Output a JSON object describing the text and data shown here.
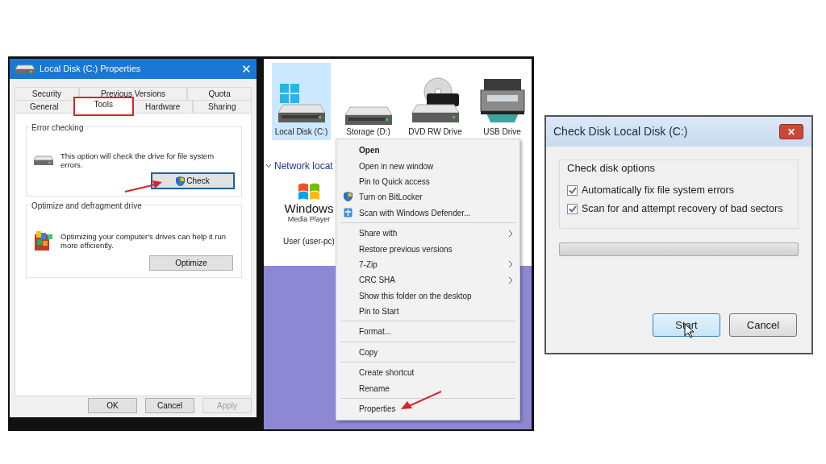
{
  "properties_dialog": {
    "title": "Local Disk (C:) Properties",
    "tab_rows": [
      [
        {
          "label": "Security",
          "selected": false,
          "highlighted": false
        },
        {
          "label": "Previous Versions",
          "selected": false,
          "highlighted": false
        },
        {
          "label": "Quota",
          "selected": false,
          "highlighted": false
        }
      ],
      [
        {
          "label": "General",
          "selected": false,
          "highlighted": false
        },
        {
          "label": "Tools",
          "selected": true,
          "highlighted": true
        },
        {
          "label": "Hardware",
          "selected": false,
          "highlighted": false
        },
        {
          "label": "Sharing",
          "selected": false,
          "highlighted": false
        }
      ]
    ],
    "groups": [
      {
        "title": "Error checking",
        "kind": "drive",
        "text": "This option will check the drive for file system errors.",
        "button": {
          "label": "Check",
          "focused": true,
          "shield": true,
          "pointer_arrow": true
        }
      },
      {
        "title": "Optimize and defragment drive",
        "kind": "defrag",
        "text": "Optimizing your computer's drives can help it run more efficiently.",
        "button": {
          "label": "Optimize",
          "focused": false,
          "shield": false,
          "pointer_arrow": false
        }
      }
    ],
    "buttons": [
      {
        "label": "OK",
        "disabled": false
      },
      {
        "label": "Cancel",
        "disabled": false
      },
      {
        "label": "Apply",
        "disabled": true
      }
    ],
    "close": "✕"
  },
  "explorer": {
    "drives": [
      {
        "label": "Local Disk (C:)",
        "kind": "windows-drive",
        "selected": true
      },
      {
        "label": "Storage (D:)",
        "kind": "drive",
        "selected": false
      },
      {
        "label": "DVD RW Drive",
        "kind": "dvd",
        "selected": false
      },
      {
        "label": "USB Drive",
        "kind": "printer",
        "selected": false
      }
    ],
    "section": {
      "label": "Network locat",
      "expanded": true
    },
    "network_items": [
      {
        "logo_text": [
          "Windows",
          "Media Player"
        ],
        "label": "User (user-pc)"
      }
    ]
  },
  "context_menu": [
    {
      "kind": "item",
      "label": "Open",
      "default": true,
      "submenu": false,
      "pointer_arrow": false
    },
    {
      "kind": "item",
      "label": "Open in new window",
      "default": false,
      "submenu": false,
      "pointer_arrow": false
    },
    {
      "kind": "item",
      "label": "Pin to Quick access",
      "default": false,
      "submenu": false,
      "pointer_arrow": false
    },
    {
      "kind": "shield-item",
      "label": "Turn on BitLocker",
      "default": false,
      "submenu": false,
      "pointer_arrow": false
    },
    {
      "kind": "defender-item",
      "label": "Scan with Windows Defender...",
      "default": false,
      "submenu": false,
      "pointer_arrow": false
    },
    {
      "kind": "separator"
    },
    {
      "kind": "item",
      "label": "Share with",
      "default": false,
      "submenu": true,
      "pointer_arrow": false
    },
    {
      "kind": "item",
      "label": "Restore previous versions",
      "default": false,
      "submenu": false,
      "pointer_arrow": false
    },
    {
      "kind": "item",
      "label": "7-Zip",
      "default": false,
      "submenu": true,
      "pointer_arrow": false
    },
    {
      "kind": "item",
      "label": "CRC SHA",
      "default": false,
      "submenu": true,
      "pointer_arrow": false
    },
    {
      "kind": "item",
      "label": "Show this folder on the desktop",
      "default": false,
      "submenu": false,
      "pointer_arrow": false
    },
    {
      "kind": "item",
      "label": "Pin to Start",
      "default": false,
      "submenu": false,
      "pointer_arrow": false
    },
    {
      "kind": "separator"
    },
    {
      "kind": "item",
      "label": "Format...",
      "default": false,
      "submenu": false,
      "pointer_arrow": false
    },
    {
      "kind": "separator"
    },
    {
      "kind": "item",
      "label": "Copy",
      "default": false,
      "submenu": false,
      "pointer_arrow": false
    },
    {
      "kind": "separator"
    },
    {
      "kind": "item",
      "label": "Create shortcut",
      "default": false,
      "submenu": false,
      "pointer_arrow": false
    },
    {
      "kind": "item",
      "label": "Rename",
      "default": false,
      "submenu": false,
      "pointer_arrow": false
    },
    {
      "kind": "separator"
    },
    {
      "kind": "item",
      "label": "Properties",
      "default": false,
      "submenu": false,
      "pointer_arrow": true
    }
  ],
  "check_disk_dialog": {
    "title": "Check Disk Local Disk (C:)",
    "close": "✕",
    "group_title": "Check disk options",
    "options": [
      {
        "label": "Automatically fix file system errors",
        "checked": true
      },
      {
        "label": "Scan for and attempt recovery of bad sectors",
        "checked": true
      }
    ],
    "progress": {
      "level": 0
    },
    "buttons": [
      {
        "label": "Start",
        "focused": true,
        "cursor": true
      },
      {
        "label": "Cancel",
        "focused": false,
        "cursor": false
      }
    ]
  }
}
